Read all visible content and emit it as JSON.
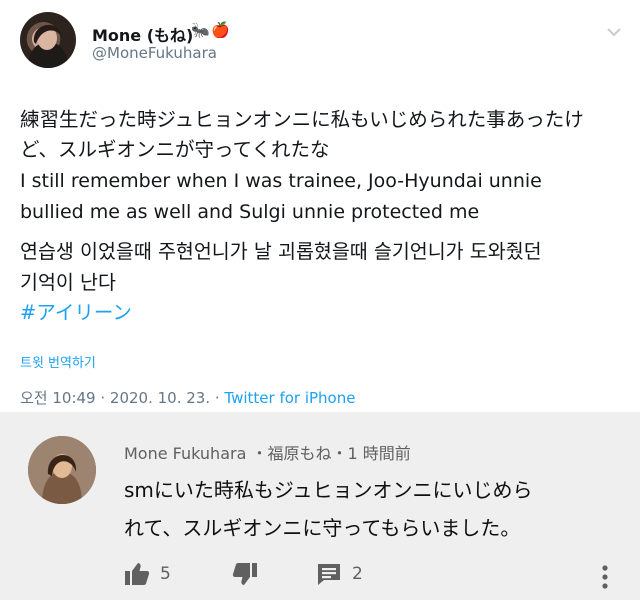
{
  "tweet": {
    "display_name": "Mone (もね)",
    "emojis": [
      "🐜",
      "🍎"
    ],
    "handle": "@MoneFukuhara",
    "lines": [
      "練習生だった時ジュヒョンオンニに私もいじめられた事あったけ",
      "ど、スルギオンニが守ってくれたな",
      "I still remember when I was trainee, Joo-Hyundai unnie",
      "bullied me as well and Sulgi unnie protected me",
      "연습생 이었을때 주현언니가 날 괴롭혔을때 슬기언니가 도와줬던",
      "기억이 난다"
    ],
    "hashtag": "#アイリーン",
    "translate_label": "트윗 번역하기",
    "timestamp": "오전 10:49 · 2020. 10. 23. · ",
    "source": "Twitter for iPhone"
  },
  "comment": {
    "author_line": "Mone Fukuhara ・福原もね・1 時間前",
    "lines": [
      "smにいた時私もジュヒョンオンニにいじめら",
      "れて、スルギオンニに守ってもらいました。"
    ],
    "likes": "5",
    "replies": "2",
    "icons": [
      "thumb-up-icon",
      "thumb-down-icon",
      "reply-icon",
      "more-vertical-icon"
    ]
  }
}
